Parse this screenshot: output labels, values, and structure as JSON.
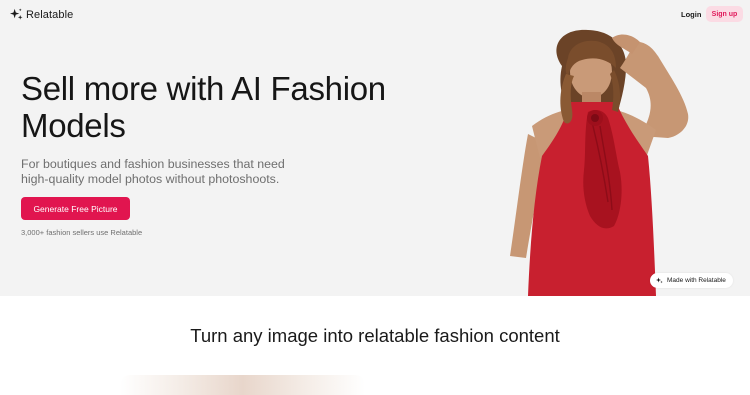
{
  "header": {
    "logo_text": "Relatable",
    "login_label": "Login",
    "signup_label": "Sign up"
  },
  "hero": {
    "headline": "Sell more with AI Fashion Models",
    "subtitle": "For boutiques and fashion businesses that need high-quality model photos without photoshoots.",
    "cta_label": "Generate Free Picture",
    "social_proof": "3,000+ fashion sellers use Relatable",
    "badge_label": "Made with Relatable",
    "model_image": "model-in-red-dress"
  },
  "section": {
    "title": "Turn any image into relatable fashion content"
  },
  "icons": {
    "logo": "sparkle-icon",
    "badge": "sparkle-icon"
  },
  "colors": {
    "accent": "#e1154f",
    "signup_bg": "#fbdbe4",
    "signup_text": "#e0185a",
    "hero_bg": "#f3f3f3",
    "dress": "#c8202f"
  }
}
